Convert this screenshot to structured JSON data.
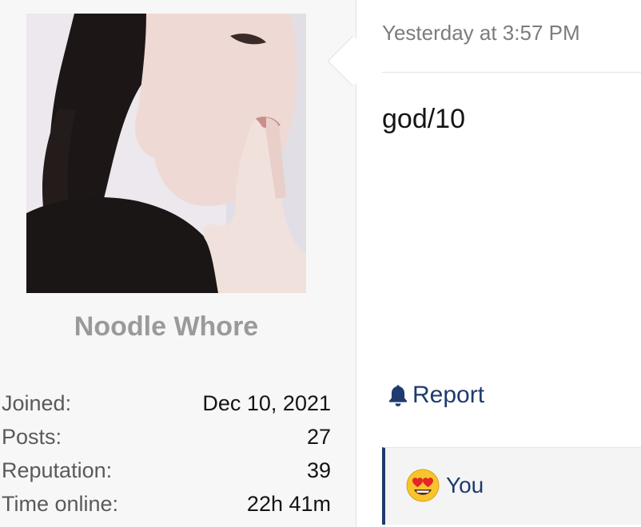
{
  "user": {
    "name": "Noodle Whore",
    "avatar_icon": "user-avatar-photo",
    "stats": [
      {
        "label": "Joined:",
        "value": "Dec 10, 2021"
      },
      {
        "label": "Posts:",
        "value": "27"
      },
      {
        "label": "Reputation:",
        "value": "39"
      },
      {
        "label": "Time online:",
        "value": "22h 41m"
      }
    ]
  },
  "post": {
    "timestamp": "Yesterday at 3:57 PM",
    "message": "god/10",
    "report_label": "Report",
    "report_icon": "bell-icon",
    "reactions": [
      {
        "emoji": "heart-eyes-emoji-icon",
        "user": "You"
      }
    ]
  },
  "colors": {
    "accent": "#1f3a6e",
    "username": "#9a9a9a",
    "muted": "#7c7c7c",
    "sidebar_bg": "#f7f7f7"
  }
}
